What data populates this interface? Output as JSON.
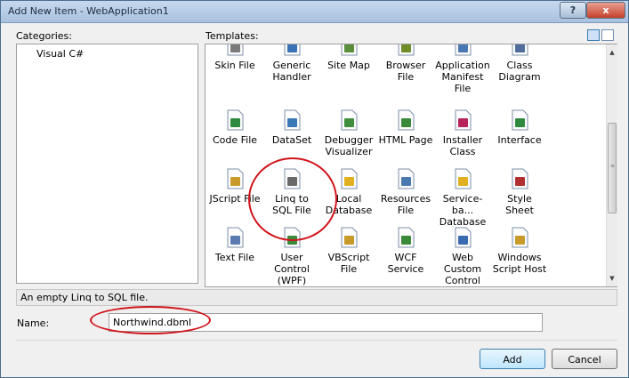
{
  "window": {
    "title": "Add New Item - WebApplication1",
    "help_label": "?",
    "close_label": "x"
  },
  "categories": {
    "label": "Categories:",
    "items": [
      "Visual C#"
    ]
  },
  "templates": {
    "label": "Templates:",
    "view_modes": [
      "large-icons-view",
      "small-icons-view"
    ],
    "items": [
      {
        "label": "Skin File",
        "icon": "skin-file-icon",
        "color": "#7a7a7a"
      },
      {
        "label": "Generic Handler",
        "icon": "generic-handler-icon",
        "color": "#3a72b8"
      },
      {
        "label": "Site Map",
        "icon": "site-map-icon",
        "color": "#5a8d3c"
      },
      {
        "label": "Browser File",
        "icon": "browser-file-icon",
        "color": "#6f8d2a"
      },
      {
        "label": "Application Manifest File",
        "icon": "application-manifest-icon",
        "color": "#4a78b2"
      },
      {
        "label": "Class Diagram",
        "icon": "class-diagram-icon",
        "color": "#4f6e9e"
      },
      {
        "label": "Code File",
        "icon": "code-file-icon",
        "color": "#2f8a3f"
      },
      {
        "label": "DataSet",
        "icon": "dataset-icon",
        "color": "#3b78b6"
      },
      {
        "label": "Debugger Visualizer",
        "icon": "debugger-visualizer-icon",
        "color": "#3f8f3f"
      },
      {
        "label": "HTML Page",
        "icon": "html-page-icon",
        "color": "#3a8a3a"
      },
      {
        "label": "Installer Class",
        "icon": "installer-class-icon",
        "color": "#b7245c"
      },
      {
        "label": "Interface",
        "icon": "interface-icon",
        "color": "#2f8a3f"
      },
      {
        "label": "JScript File",
        "icon": "jscript-file-icon",
        "color": "#c89a2a"
      },
      {
        "label": "Linq to SQL File",
        "icon": "linq-to-sql-file-icon",
        "color": "#6a6a6a"
      },
      {
        "label": "Local Database",
        "icon": "local-database-icon",
        "color": "#e0b020"
      },
      {
        "label": "Resources File",
        "icon": "resources-file-icon",
        "color": "#4a7ab0"
      },
      {
        "label": "Service-ba... Database",
        "icon": "service-based-database-icon",
        "color": "#e0b020"
      },
      {
        "label": "Style Sheet",
        "icon": "style-sheet-icon",
        "color": "#b03030"
      },
      {
        "label": "Text File",
        "icon": "text-file-icon",
        "color": "#5a7ab0"
      },
      {
        "label": "User Control (WPF)",
        "icon": "user-control-wpf-icon",
        "color": "#3a8a3a"
      },
      {
        "label": "VBScript File",
        "icon": "vbscript-file-icon",
        "color": "#c89a2a"
      },
      {
        "label": "WCF Service",
        "icon": "wcf-service-icon",
        "color": "#3a8a3a"
      },
      {
        "label": "Web Custom Control",
        "icon": "web-custom-control-icon",
        "color": "#3a6ab0"
      },
      {
        "label": "Windows Script Host",
        "icon": "windows-script-host-icon",
        "color": "#c89a2a"
      }
    ]
  },
  "description": "An empty Linq to SQL file.",
  "name_field": {
    "label": "Name:",
    "value": "Northwind.dbml"
  },
  "buttons": {
    "add": "Add",
    "cancel": "Cancel"
  }
}
